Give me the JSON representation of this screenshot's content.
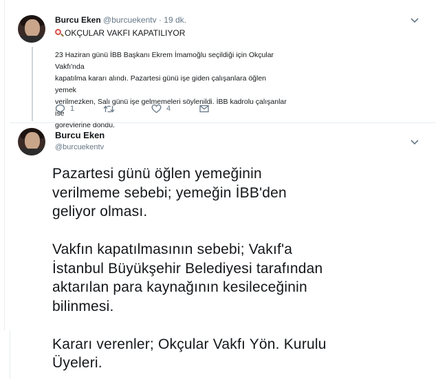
{
  "tweet1": {
    "author_name": "Burcu Eken",
    "handle": "@burcuekentv",
    "separator": "·",
    "time": "19 dk.",
    "title": "OKÇULAR VAKFI KAPATILIYOR",
    "title_icon": "magnifier-emoji-icon",
    "body_lines": [
      "23 Haziran günü İBB Başkanı Ekrem İmamoğlu seçildiği için Okçular Vakfı'nda",
      "kapatılma kararı alındı. Pazartesi günü işe giden çalışanlara öğlen yemek",
      "verilmezken, Salı günü işe gelmemeleri söylenildi. İBB kadrolu çalışanlar ise",
      "görevlerine döndü."
    ],
    "reply_count": "1",
    "retweet_count": "",
    "like_count": "4"
  },
  "tweet2": {
    "author_name": "Burcu Eken",
    "handle": "@burcuekentv",
    "paragraph1": [
      "Pazartesi günü öğlen yemeğinin",
      "verilmeme sebebi; yemeğin İBB'den",
      "geliyor olması."
    ],
    "paragraph2": [
      "Vakfın kapatılmasının sebebi; Vakıf'a",
      "İstanbul Büyükşehir Belediyesi tarafından",
      "aktarılan para kaynağının kesileceğinin",
      "bilinmesi."
    ],
    "paragraph3": [
      "Kararı verenler; Okçular Vakfı Yön. Kurulu",
      "Üyeleri."
    ]
  },
  "colors": {
    "text": "#14171a",
    "secondary": "#657786",
    "border": "#e6ecf0",
    "thread_line": "#ccd6dd"
  }
}
